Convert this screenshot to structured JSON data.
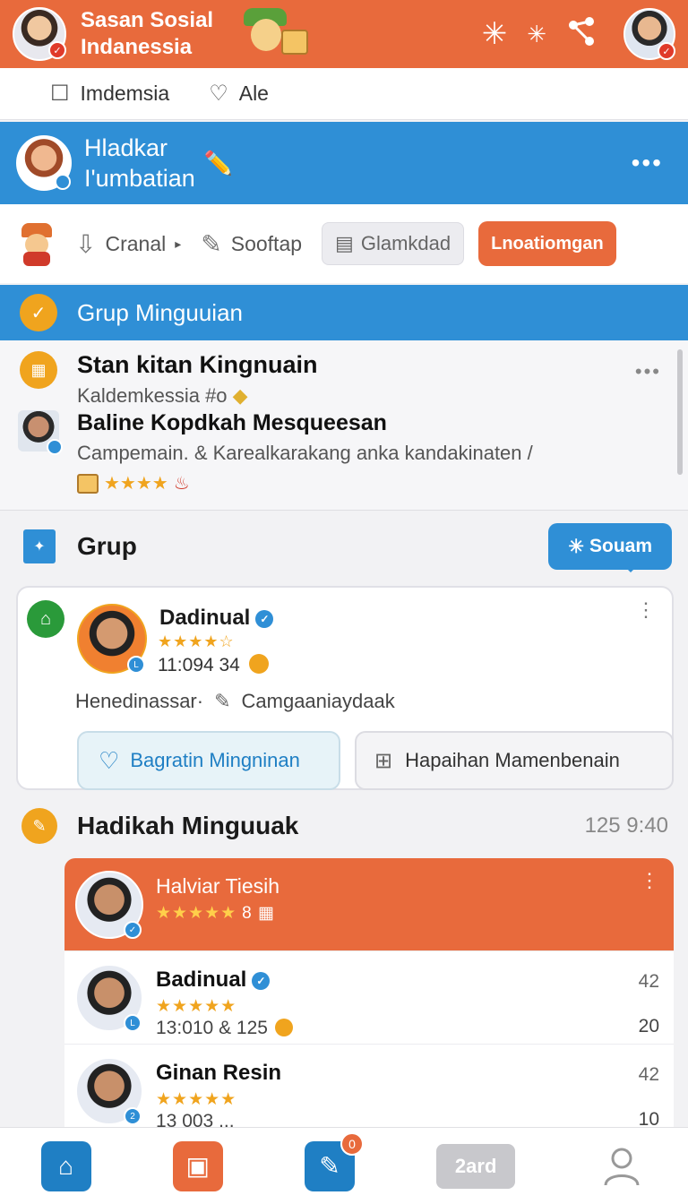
{
  "header": {
    "title_line1": "Sasan Sosial",
    "title_line2": "Indanessia",
    "icons": [
      "sparkle-icon",
      "sparkle-small-icon",
      "share-icon"
    ]
  },
  "filter": {
    "items": [
      {
        "label": "Imdemsia",
        "icon": "bookmark-icon"
      },
      {
        "label": "Ale",
        "icon": "heart-icon"
      }
    ]
  },
  "banner": {
    "line1": "Hladkar",
    "line2": "I'umbatian",
    "more": "•••"
  },
  "actions": {
    "crawl": "Cranal",
    "softap": "Sooftap",
    "chip": "Glamkdad",
    "cta": "Lnoatiomgan"
  },
  "group_header": {
    "title": "Grup Minguuian"
  },
  "feed": {
    "item1": {
      "title": "Stan kitan Kingnuain",
      "subtitle": "Kaldemkessia #o"
    },
    "item2": {
      "title": "Baline Kopdkah Mesqueesan",
      "subtitle": "Campemain. & Karealkarakang anka kandakinaten /",
      "stars": "★★★★"
    },
    "more": "•••"
  },
  "grup": {
    "title": "Grup",
    "button": "Souam"
  },
  "member_card": {
    "name": "Dadinual",
    "stars": "★★★★☆",
    "time": "11:094 34",
    "line_left": "Henedinassar·",
    "line_right": "Camgaaniaydaak",
    "button_like": "Bagratin Mingninan",
    "button_add": "Hapaihan  Mamenbenain"
  },
  "ranking": {
    "title": "Hadikah Minguuak",
    "time": "125 9:40",
    "items": [
      {
        "name": "Halviar Tiesih",
        "stars": "★★★★★",
        "extra": "8"
      },
      {
        "name": "Badinual",
        "stars": "★★★★★",
        "sub": "13:010 & 125",
        "r1": "42",
        "r2": "20"
      },
      {
        "name": "Ginan Resin",
        "stars": "★★★★★",
        "sub": "13 003 ...",
        "r1": "42",
        "r2": "10"
      }
    ]
  },
  "bottom_nav": {
    "badge": "0",
    "card_label": "2ard"
  }
}
